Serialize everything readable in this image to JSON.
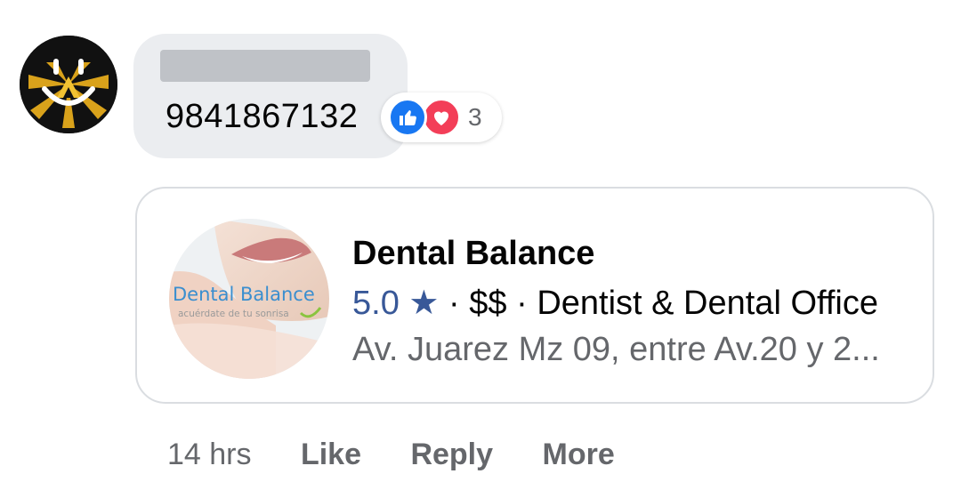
{
  "comment": {
    "author_avatar_icon": "user-avatar-icon",
    "text": "9841867132",
    "reactions": {
      "icons": [
        "like-reaction-icon",
        "love-reaction-icon"
      ],
      "count": "3",
      "colors": {
        "like": "#1877f2",
        "love": "#f33e58"
      }
    }
  },
  "business_card": {
    "image_text": "Dental Balance",
    "image_tagline": "acuérdate de tu sonrisa",
    "name": "Dental Balance",
    "rating": "5.0",
    "star": "★",
    "separator": "·",
    "price": "$$",
    "category": "Dentist & Dental Office",
    "address": "Av. Juarez Mz 09, entre Av.20 y 2..."
  },
  "actions": {
    "timestamp": "14 hrs",
    "like": "Like",
    "reply": "Reply",
    "more": "More"
  },
  "colors": {
    "bubble_bg": "#ebedf0",
    "link_blue": "#385898",
    "secondary_text": "#65676b"
  }
}
